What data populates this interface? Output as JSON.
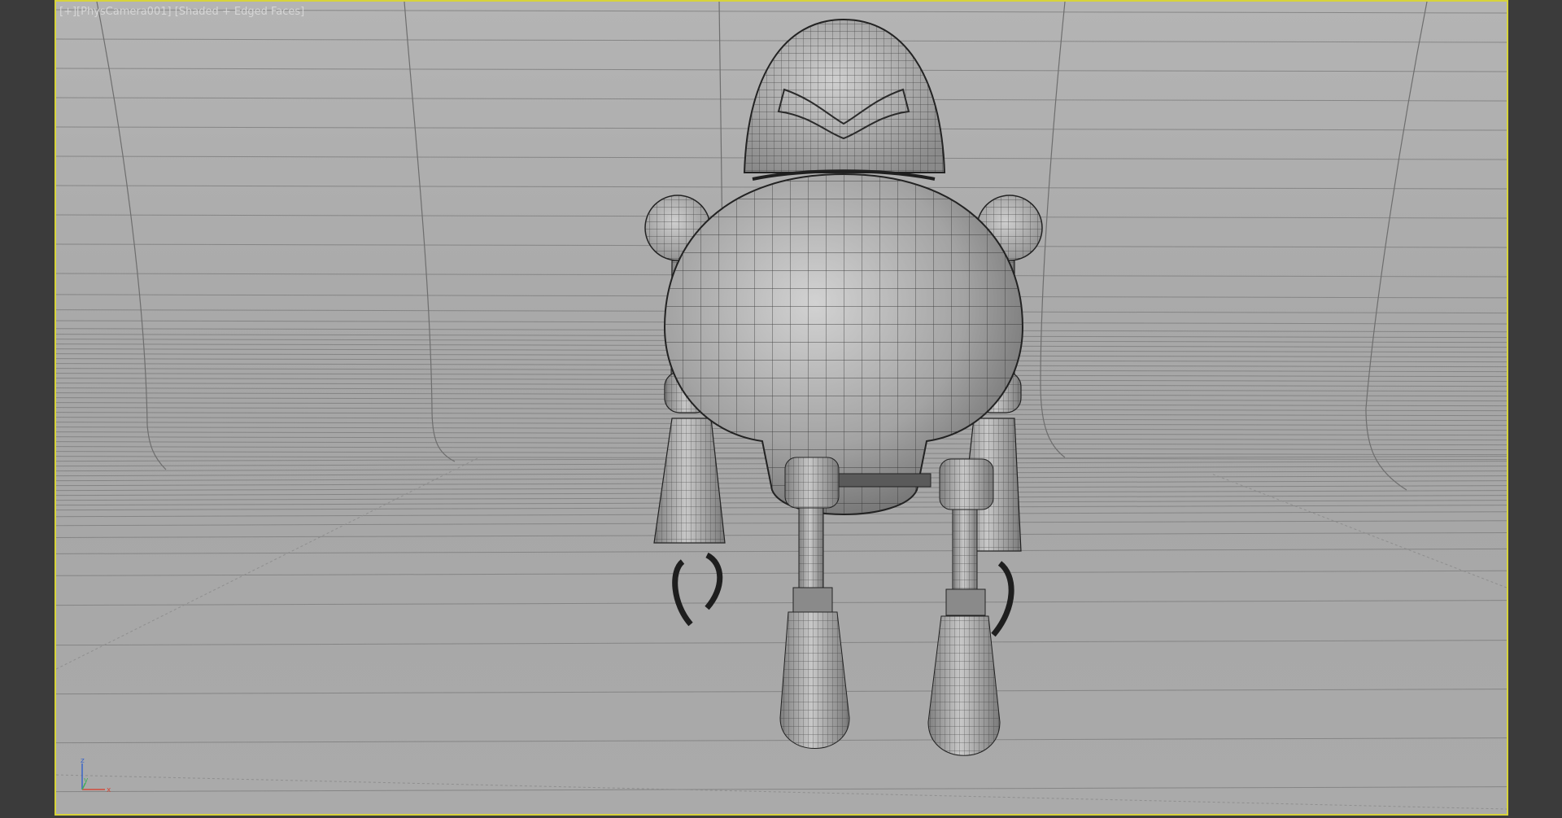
{
  "viewport": {
    "menu_label": "[+]",
    "camera_label": "[PhysCamera001]",
    "shading_label": "[Shaded + Edged Faces]",
    "active_border_color": "#d7d33a",
    "background_color": "#a8a8a8"
  },
  "scene": {
    "model": "robot-mesh",
    "backdrop": "curved-cyclorama-wireframe"
  },
  "axis_gizmo": {
    "z_label": "z",
    "y_label": "y",
    "x_label": "x",
    "x_color": "#d24a3a",
    "y_color": "#3fae5a",
    "z_color": "#3a64c8"
  }
}
